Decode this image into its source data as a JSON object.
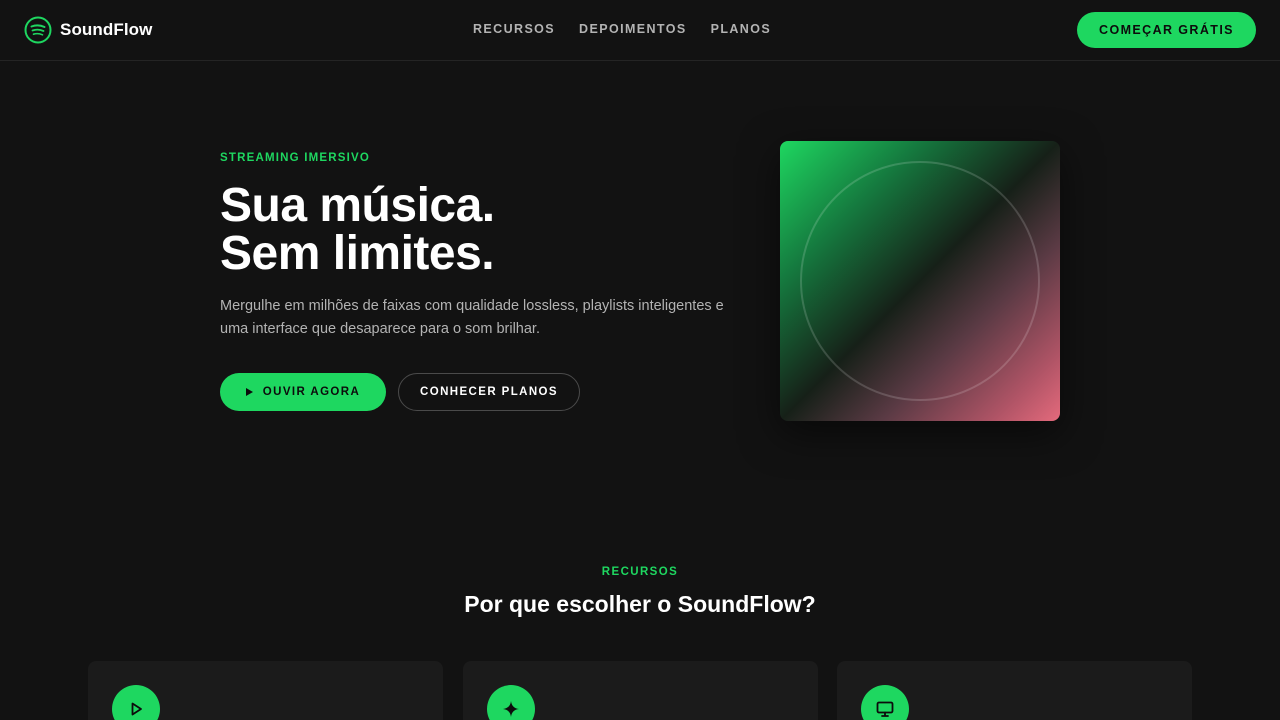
{
  "brand": {
    "name": "SoundFlow",
    "logo_icon": "soundwave-logo-icon",
    "accent_color": "#1ed760"
  },
  "nav": {
    "links": [
      "RECURSOS",
      "DEPOIMENTOS",
      "PLANOS"
    ],
    "cta_label": "COMEÇAR GRÁTIS"
  },
  "hero": {
    "eyebrow": "STREAMING IMERSIVO",
    "title_line1": "Sua música.",
    "title_line2": "Sem limites.",
    "description": "Mergulhe em milhões de faixas com qualidade lossless, playlists inteligentes e uma interface que desaparece para o som brilhar.",
    "primary_button": {
      "label": "OUVIR AGORA",
      "icon": "play-icon"
    },
    "secondary_button": {
      "label": "CONHECER PLANOS"
    },
    "art_colors": [
      "#1ed760",
      "#162018",
      "#e46a7c"
    ]
  },
  "features": {
    "eyebrow": "RECURSOS",
    "title": "Por que escolher o SoundFlow?",
    "cards": [
      {
        "icon": "play-icon"
      },
      {
        "icon": "sparkle-icon"
      },
      {
        "icon": "monitor-icon"
      }
    ]
  },
  "colors": {
    "background": "#121212",
    "card": "#1b1b1b",
    "text_muted": "#b3b3b3"
  }
}
